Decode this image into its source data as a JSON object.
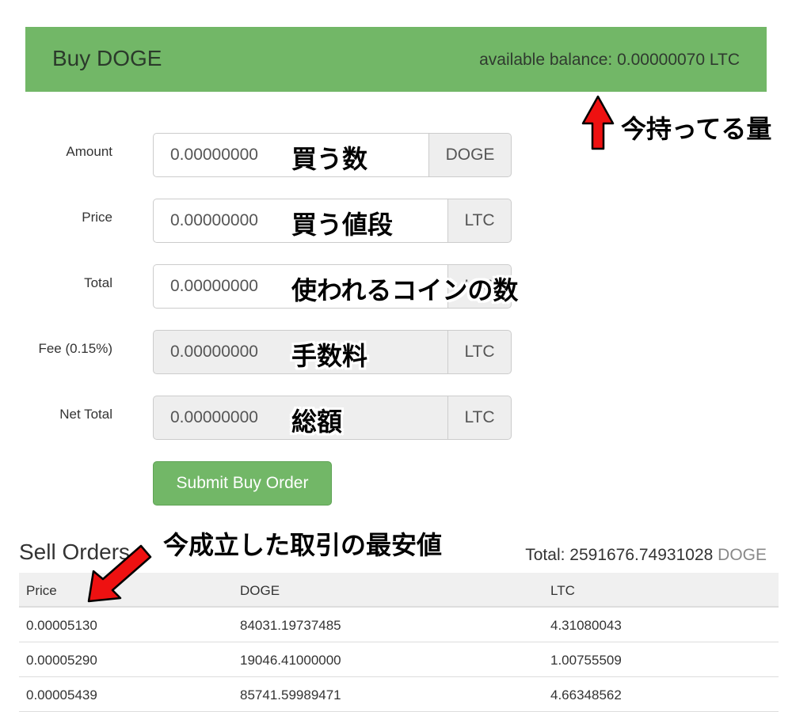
{
  "header": {
    "title": "Buy DOGE",
    "balance_label": "available balance: ",
    "balance_value": "0.00000070",
    "balance_unit": " LTC"
  },
  "form": {
    "amount": {
      "label": "Amount",
      "value": "0.00000000",
      "unit": "DOGE"
    },
    "price": {
      "label": "Price",
      "value": "0.00000000",
      "unit": "LTC"
    },
    "total": {
      "label": "Total",
      "value": "0.00000000",
      "unit": "LTC"
    },
    "fee": {
      "label": "Fee (0.15%)",
      "value": "0.00000000",
      "unit": "LTC"
    },
    "net_total": {
      "label": "Net Total",
      "value": "0.00000000",
      "unit": "LTC"
    },
    "submit_label": "Submit Buy Order"
  },
  "annotations": {
    "balance_note": "今持ってる量",
    "amount_note": "買う数",
    "price_note": "買う値段",
    "total_note": "使われるコインの数",
    "fee_note": "手数料",
    "net_total_note": "総額",
    "lowest_price_note": "今成立した取引の最安値"
  },
  "sell_orders": {
    "title": "Sell Orders",
    "total_label": "Total: ",
    "total_value": "2591676.74931028",
    "total_unit": " DOGE",
    "columns": [
      "Price",
      "DOGE",
      "LTC"
    ],
    "rows": [
      [
        "0.00005130",
        "84031.19737485",
        "4.31080043"
      ],
      [
        "0.00005290",
        "19046.41000000",
        "1.00755509"
      ],
      [
        "0.00005439",
        "85741.59989471",
        "4.66348562"
      ]
    ]
  },
  "colors": {
    "header_green": "#72b767",
    "arrow_red": "#ee1111"
  }
}
